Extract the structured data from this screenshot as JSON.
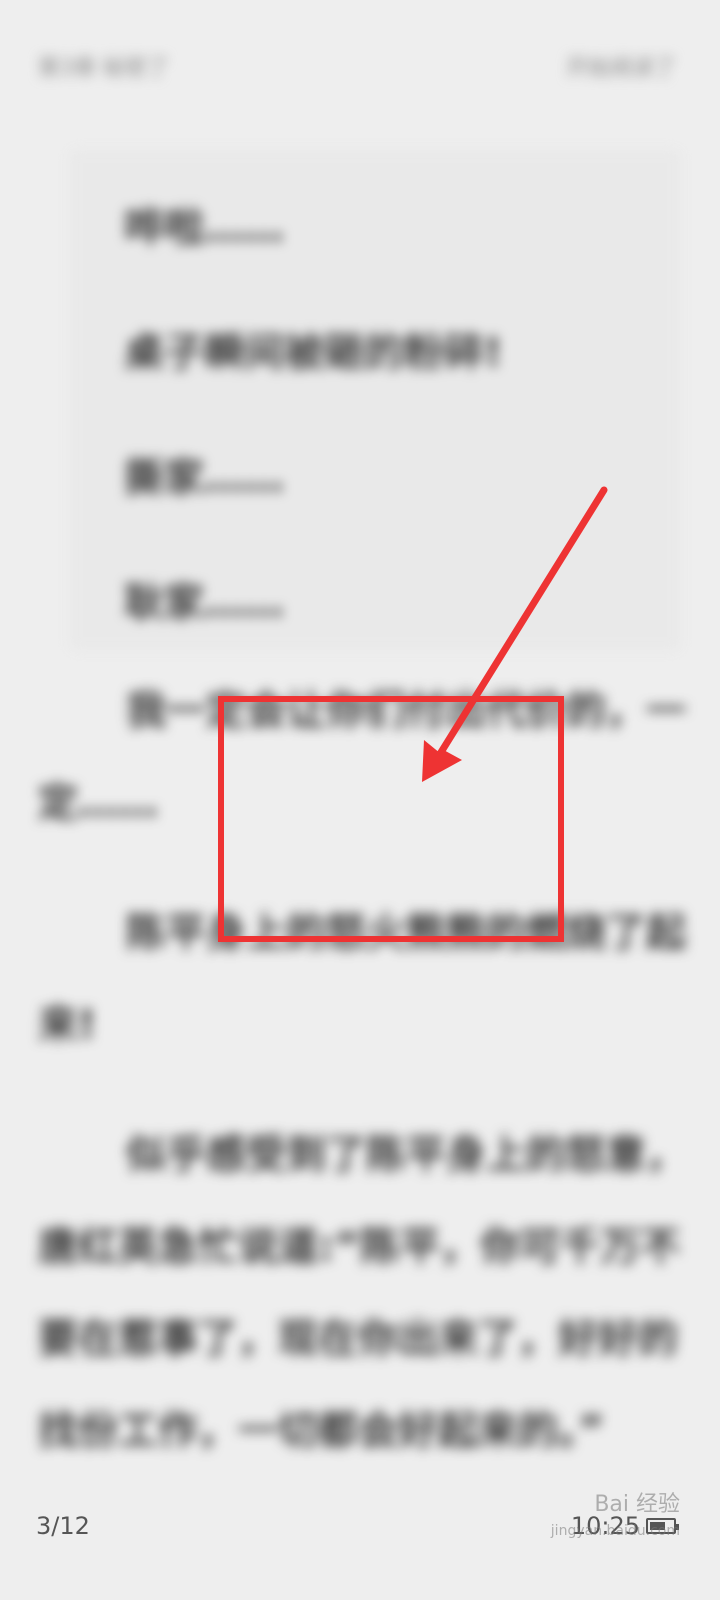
{
  "header": {
    "chapter_title": "第3章 秘密了",
    "progress_label": "开始阅读了"
  },
  "quote": {
    "lines": [
      "哗啦……",
      "桌子瞬间被砸的粉碎!",
      "撕家……",
      "耿家……"
    ]
  },
  "body": {
    "paragraphs": [
      "我一定会让你们付出代价的，一定……",
      "陈平身上的怒火熊熊的燃烧了起来!",
      "似乎感受到了陈平身上的怒意，唐红英急忙说道:“陈平，你可千万不要在惹事了，现在你出来了，好好的找份工作，一切都会好起来的。”"
    ]
  },
  "footer": {
    "page_indicator": "3/12",
    "time": "10:25",
    "battery_level": 0.7
  },
  "watermark": {
    "brand": "Bai 经验",
    "url": "jingyan.baidu.com"
  },
  "annotation": {
    "color": "#ee3333"
  }
}
